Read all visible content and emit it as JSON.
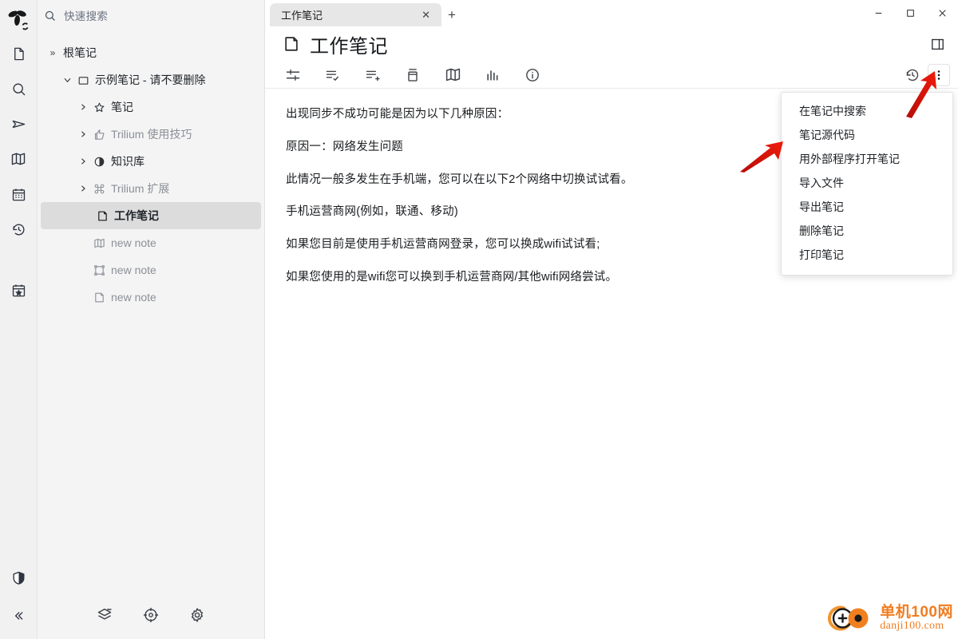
{
  "window": {
    "minimize_label": "—",
    "maximize_label": "□",
    "close_label": "✕"
  },
  "rail": {
    "items": [
      {
        "name": "logo",
        "label": "Trilium"
      },
      {
        "name": "note",
        "label": "笔记"
      },
      {
        "name": "search",
        "label": "搜索"
      },
      {
        "name": "send",
        "label": "分享"
      },
      {
        "name": "book",
        "label": "笔记本"
      },
      {
        "name": "calendar",
        "label": "日历"
      },
      {
        "name": "history",
        "label": "历史记录"
      },
      {
        "name": "calendar-star",
        "label": "今日笔记"
      },
      {
        "name": "shield",
        "label": "受保护的笔记"
      },
      {
        "name": "collapse",
        "label": "«"
      }
    ]
  },
  "sidebar": {
    "search": {
      "placeholder": "快速搜索",
      "icon": "search-icon"
    },
    "tree": [
      {
        "label": "根笔记",
        "icon": "chevrons-right-icon",
        "twisty": "»",
        "level": 0,
        "muted": false,
        "selected": false
      },
      {
        "label": "示例笔记 - 请不要删除",
        "icon": "folder-icon",
        "twisty": "⌄",
        "level": 1,
        "muted": false,
        "selected": false
      },
      {
        "label": "笔记",
        "icon": "star-icon",
        "twisty": "›",
        "level": 2,
        "muted": false,
        "selected": false
      },
      {
        "label": "Trilium 使用技巧",
        "icon": "thumbs-up-icon",
        "twisty": "›",
        "level": 2,
        "muted": true,
        "selected": false
      },
      {
        "label": "知识库",
        "icon": "contrast-icon",
        "twisty": "›",
        "level": 2,
        "muted": false,
        "selected": false
      },
      {
        "label": "Trilium 扩展",
        "icon": "command-icon",
        "twisty": "›",
        "level": 2,
        "muted": true,
        "selected": false
      },
      {
        "label": "工作笔记",
        "icon": "note-icon",
        "twisty": "",
        "level": 2,
        "muted": false,
        "selected": true
      },
      {
        "label": "new note",
        "icon": "book-icon",
        "twisty": "",
        "level": 2,
        "muted": true,
        "selected": false
      },
      {
        "label": "new note",
        "icon": "canvas-icon",
        "twisty": "",
        "level": 2,
        "muted": true,
        "selected": false
      },
      {
        "label": "new note",
        "icon": "note-icon",
        "twisty": "",
        "level": 2,
        "muted": true,
        "selected": false
      }
    ],
    "bottom_buttons": [
      {
        "name": "layers-icon",
        "label": "笔记层级"
      },
      {
        "name": "target-icon",
        "label": "定位当前笔记"
      },
      {
        "name": "gear-icon",
        "label": "选项"
      }
    ]
  },
  "tabs": {
    "items": [
      {
        "label": "工作笔记",
        "active": true,
        "close_label": "✕"
      }
    ],
    "new_tab_label": "+"
  },
  "note": {
    "title": "工作笔记",
    "icon": "note-icon",
    "panel_toggle_icon": "panel-right-icon"
  },
  "toolbar": {
    "buttons": [
      {
        "name": "attributes-icon",
        "label": "笔记属性"
      },
      {
        "name": "list-check-icon",
        "label": "任务列表"
      },
      {
        "name": "list-add-icon",
        "label": "添加列表项"
      },
      {
        "name": "archive-icon",
        "label": "归档"
      },
      {
        "name": "book-icon",
        "label": "笔记本"
      },
      {
        "name": "chart-icon",
        "label": "统计"
      },
      {
        "name": "info-icon",
        "label": "信息"
      }
    ],
    "right_buttons": [
      {
        "name": "history-icon",
        "label": "笔记修订"
      },
      {
        "name": "kebab-menu-icon",
        "label": "更多操作"
      }
    ]
  },
  "content": {
    "paragraphs": [
      {
        "text": "出现同步不成功可能是因为以下几种原因：",
        "dim": ""
      },
      {
        "text": "原因一：网络发生问题",
        "dim": ""
      },
      {
        "text": "此情况一般多发生在手机端，您可以在以下2个网络中切换试试看。",
        "dim": ""
      },
      {
        "text": "手机运营商网(例如，联通、移动)",
        "dim": ""
      },
      {
        "text": "如果您目前是使用手机运营商网登录，您可以换成wifi试试看;",
        "dim": ""
      },
      {
        "text": "如果您使用的是wifi您可以换到手机运营商网/其他wifi网络尝试。",
        "dim": ""
      }
    ]
  },
  "dropdown": {
    "visible": true,
    "items": [
      {
        "label": "在笔记中搜索"
      },
      {
        "label": "笔记源代码"
      },
      {
        "label": "用外部程序打开笔记"
      },
      {
        "label": "导入文件"
      },
      {
        "label": "导出笔记"
      },
      {
        "label": "删除笔记"
      },
      {
        "label": "打印笔记"
      }
    ]
  },
  "annotations": {
    "arrow_color": "#e81a0c",
    "arrows": [
      {
        "name": "arrow-pointing-to-menu"
      },
      {
        "name": "arrow-pointing-to-kebab-button"
      }
    ]
  },
  "watermark": {
    "cn": "单机100网",
    "en": "danji100.com",
    "color": "#f07d22"
  },
  "colors": {
    "sidebar_bg": "#f4f4f4",
    "rail_bg": "#f1f1f1",
    "selected_bg": "#dcdcdc",
    "accent": "#f07d22"
  }
}
